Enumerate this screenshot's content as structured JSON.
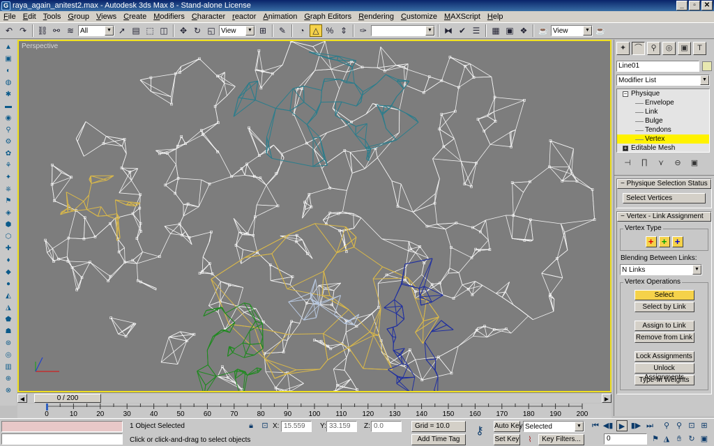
{
  "window": {
    "title": "raya_again_anitest2.max - Autodesk 3ds Max 8 - Stand-alone License",
    "app_icon_letter": "G",
    "controls": [
      "_",
      "▫",
      "✕"
    ]
  },
  "menubar": [
    "File",
    "Edit",
    "Tools",
    "Group",
    "Views",
    "Create",
    "Modifiers",
    "Character",
    "reactor",
    "Animation",
    "Graph Editors",
    "Rendering",
    "Customize",
    "MAXScript",
    "Help"
  ],
  "toolbar": {
    "selection_filter": "All",
    "reference_coord": "View",
    "named_selection": "",
    "render_view": "View",
    "icons": [
      "undo-icon",
      "redo-icon",
      "select-link-icon",
      "unlink-icon",
      "bind-space-warp-icon",
      "select-object-icon",
      "select-by-name-icon",
      "rectangular-selection-icon",
      "window-crossing-icon",
      "move-icon",
      "rotate-icon",
      "scale-icon",
      "pivot-center-icon",
      "manipulate-icon",
      "snap-toggle-icon",
      "angle-snap-icon",
      "percent-snap-icon",
      "spinner-snap-icon",
      "edit-named-selection-icon",
      "mirror-icon",
      "align-icon",
      "layer-manager-icon",
      "curve-editor-icon",
      "schematic-view-icon",
      "material-editor-icon",
      "render-scene-icon",
      "quick-render-icon"
    ]
  },
  "viewport": {
    "label": "Perspective",
    "background": "#7d7d7d",
    "border_color": "#f0e020"
  },
  "command_panel": {
    "object_name": "Line01",
    "modifier_list": "Modifier List",
    "stack": [
      {
        "label": "Physique",
        "level": "top",
        "expander": "minus"
      },
      {
        "label": "Envelope",
        "level": "sub"
      },
      {
        "label": "Link",
        "level": "sub"
      },
      {
        "label": "Bulge",
        "level": "sub"
      },
      {
        "label": "Tendons",
        "level": "sub"
      },
      {
        "label": "Vertex",
        "level": "sub",
        "selected": true
      },
      {
        "label": "Editable Mesh",
        "level": "top",
        "expander": "plus"
      }
    ],
    "rollout1": {
      "title": "Physique Selection Status",
      "value": "Select Vertices"
    },
    "rollout2": {
      "title": "Vertex - Link Assignment",
      "vertex_type_label": "Vertex Type",
      "vertex_type_colors": [
        "#e00000",
        "#00a000",
        "#0000d0"
      ],
      "blending_label": "Blending Between Links:",
      "blending_value": "N Links",
      "vertex_ops_label": "Vertex Operations",
      "buttons": [
        "Select",
        "Select by Link",
        "Assign to Link",
        "Remove from Link",
        "Lock Assignments",
        "Unlock Assignments",
        "Type-In Weights"
      ]
    }
  },
  "timeslider": {
    "frame_display": "0 / 200"
  },
  "trackbar": {
    "ticks": [
      0,
      10,
      20,
      30,
      40,
      50,
      60,
      70,
      80,
      90,
      100,
      110,
      120,
      130,
      140,
      150,
      160,
      170,
      180,
      190,
      200
    ]
  },
  "statusbar": {
    "selection_status": "1 Object Selected",
    "prompt": "Click or click-and-drag to select objects",
    "x_label": "X:",
    "x_value": "15.559",
    "y_label": "Y:",
    "y_value": "33.159",
    "z_label": "Z:",
    "z_value": "0.0",
    "grid": "Grid = 10.0",
    "add_time_tag": "Add Time Tag",
    "auto_key": "Auto Key",
    "set_key": "Set Key",
    "selected_dropdown": "Selected",
    "key_filters": "Key Filters...",
    "current_frame": "0"
  }
}
